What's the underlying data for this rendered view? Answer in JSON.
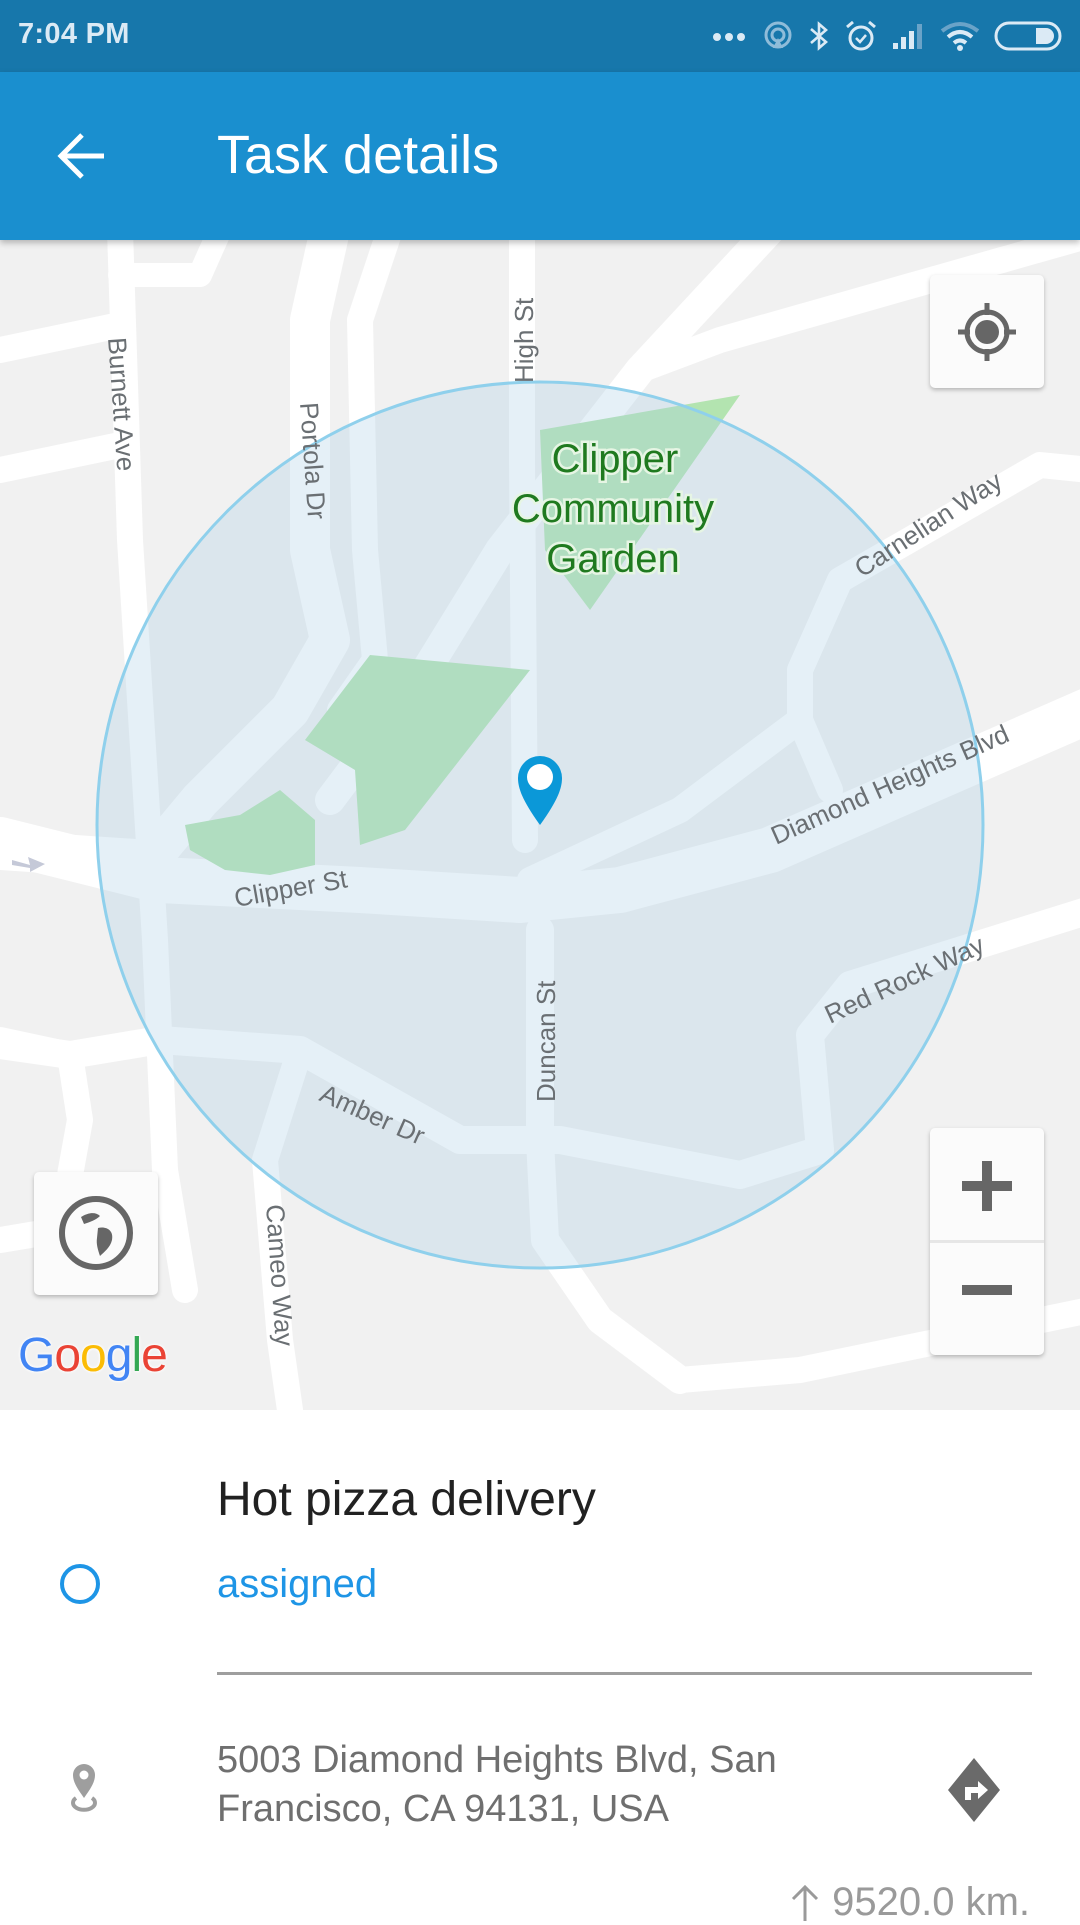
{
  "status_bar": {
    "time": "7:04 PM",
    "icons": [
      "more-notifications-icon",
      "hotspot-icon",
      "bluetooth-icon",
      "alarm-icon",
      "signal-icon",
      "wifi-icon",
      "battery-icon"
    ]
  },
  "app_bar": {
    "back_icon": "arrow-back-icon",
    "title": "Task details"
  },
  "map": {
    "park_label": "Clipper Community Garden",
    "park_label_lines": [
      "Clipper",
      "Community",
      "Garden"
    ],
    "streets": {
      "burnett": "Burnett Ave",
      "portola": "Portola Dr",
      "high": "High St",
      "carnelian": "Carnelian Way",
      "diamond": "Diamond Heights Blvd",
      "clipper": "Clipper St",
      "duncan": "Duncan St",
      "red_rock": "Red Rock Way",
      "amber": "Amber Dr",
      "cameo": "Cameo Way"
    },
    "controls": {
      "my_location_icon": "my-location-icon",
      "zoom_in": "+",
      "zoom_out": "−",
      "map_type_icon": "globe-icon"
    },
    "attribution": [
      "G",
      "o",
      "o",
      "g",
      "l",
      "e"
    ],
    "geofence_color": "#8fd0ec",
    "marker_color": "#0b98d8"
  },
  "task": {
    "title": "Hot pizza delivery",
    "status": "assigned",
    "status_color": "#1e95e6",
    "address_line1": "5003 Diamond Heights Blvd, San",
    "address_line2": "Francisco, CA 94131, USA",
    "distance": "9520.0 km.",
    "distance_icon": "arrow-up-icon",
    "directions_icon": "directions-icon"
  }
}
